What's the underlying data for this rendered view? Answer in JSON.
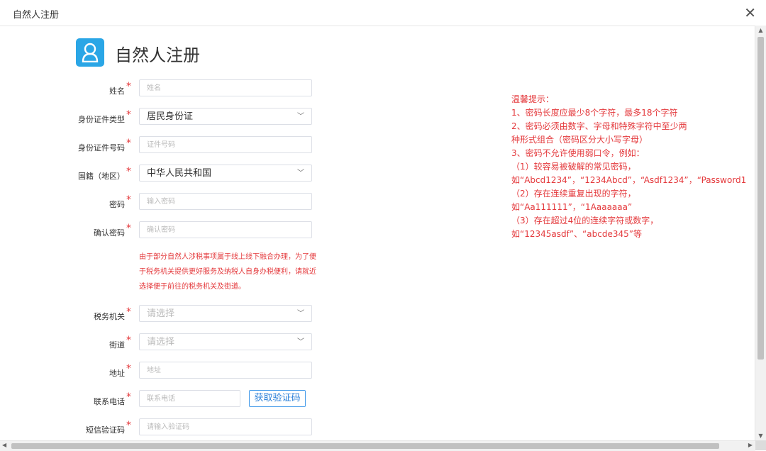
{
  "window": {
    "title": "自然人注册",
    "close_icon": "close-icon"
  },
  "heading": {
    "title": "自然人注册",
    "icon": "user-icon",
    "icon_color": "#2aa6e6"
  },
  "form": {
    "name": {
      "label": "姓名",
      "placeholder": "姓名"
    },
    "id_type": {
      "label": "身份证件类型",
      "value": "居民身份证"
    },
    "id_number": {
      "label": "身份证件号码",
      "placeholder": "证件号码"
    },
    "nationality": {
      "label": "国籍（地区）",
      "value": "中华人民共和国"
    },
    "password": {
      "label": "密码",
      "placeholder": "输入密码"
    },
    "confirm_password": {
      "label": "确认密码",
      "placeholder": "确认密码"
    },
    "notice": "由于部分自然人涉税事项属于线上线下融合办理，为了便于税务机关提供更好服务及纳税人自身办税便利，请就近选择便于前往的税务机关及街道。",
    "tax_office": {
      "label": "税务机关",
      "placeholder": "请选择"
    },
    "street": {
      "label": "街道",
      "placeholder": "请选择"
    },
    "address": {
      "label": "地址",
      "placeholder": "地址"
    },
    "phone": {
      "label": "联系电话",
      "placeholder": "联系电话",
      "button": "获取验证码"
    },
    "sms_code": {
      "label": "短信验证码",
      "placeholder": "请输入验证码"
    },
    "required_mark": "*"
  },
  "tips": {
    "lines": [
      "温馨提示：",
      "1、密码长度应最少8个字符，最多18个字符",
      "2、密码必须由数字、字母和特殊字符中至少两",
      "种形式组合（密码区分大小写字母）",
      "3、密码不允许使用弱口令，例如：",
      "（1）较容易被破解的常见密码，",
      "如“Abcd1234”，“1234Abcd”，“Asdf1234”，“Password1",
      "（2）存在连续重复出现的字符，",
      "如“Aa111111”，“1Aaaaaaa”",
      "（3）存在超过4位的连续字符或数字，",
      "如“12345asdf”、“abcde345”等"
    ]
  },
  "colors": {
    "accent": "#2aa6e6",
    "required": "#e4393c",
    "button_border": "#4a9eea"
  }
}
